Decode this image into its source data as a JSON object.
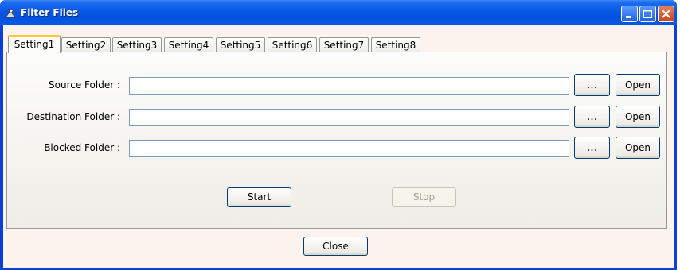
{
  "window": {
    "title": "Filter Files"
  },
  "tabs": [
    {
      "label": "Setting1",
      "active": true
    },
    {
      "label": "Setting2"
    },
    {
      "label": "Setting3"
    },
    {
      "label": "Setting4"
    },
    {
      "label": "Setting5"
    },
    {
      "label": "Setting6"
    },
    {
      "label": "Setting7"
    },
    {
      "label": "Setting8"
    }
  ],
  "fields": {
    "source": {
      "label": "Source Folder :",
      "value": "",
      "browse": "...",
      "open": "Open"
    },
    "destination": {
      "label": "Destination Folder :",
      "value": "",
      "browse": "...",
      "open": "Open"
    },
    "blocked": {
      "label": "Blocked Folder :",
      "value": "",
      "browse": "...",
      "open": "Open"
    }
  },
  "actions": {
    "start": "Start",
    "stop": "Stop",
    "close": "Close"
  },
  "colors": {
    "titlebar": "#0a5ae4",
    "active_tab_accent": "#ffc83c",
    "button_border": "#003c74"
  }
}
